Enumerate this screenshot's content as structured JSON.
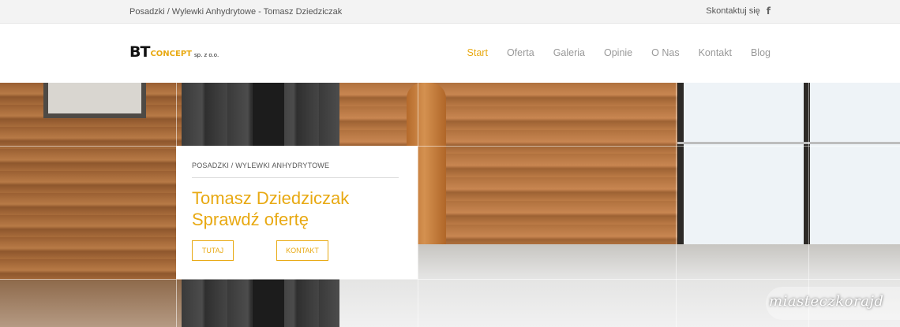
{
  "topbar": {
    "tagline": "Posadzki / Wylewki Anhydrytowe - Tomasz Dziedziczak",
    "contact_label": "Skontaktuj się",
    "social_icon": "facebook-icon"
  },
  "logo": {
    "bt": "BT",
    "concept": "CONCEPT",
    "suffix": "sp. z o.o."
  },
  "nav": {
    "items": [
      "Start",
      "Oferta",
      "Galeria",
      "Opinie",
      "O Nas",
      "Kontakt",
      "Blog"
    ],
    "active_index": 0
  },
  "hero": {
    "kicker": "POSADZKI / WYLEWKI ANHYDRYTOWE",
    "headline_line1": "Tomasz Dziedziczak",
    "headline_line2": "Sprawdź ofertę",
    "button_primary": "TUTAJ",
    "button_secondary": "KONTAKT"
  },
  "watermark": {
    "text": "miasteczkorajd"
  },
  "colors": {
    "accent": "#e8a912",
    "nav_inactive": "#999999",
    "topbar_bg": "#f3f3f3"
  }
}
